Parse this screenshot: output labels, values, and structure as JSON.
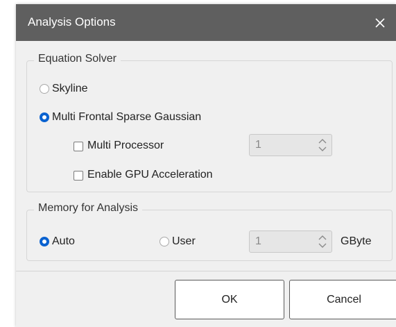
{
  "dialog": {
    "title": "Analysis Options",
    "close_icon": "close-icon"
  },
  "solver": {
    "legend": "Equation Solver",
    "skyline_label": "Skyline",
    "skyline_checked": false,
    "multifrontal_label": "Multi Frontal Sparse Gaussian",
    "multifrontal_checked": true,
    "multi_processor_label": "Multi Processor",
    "multi_processor_checked": false,
    "multi_processor_value": "1",
    "gpu_label": "Enable GPU Acceleration",
    "gpu_checked": false
  },
  "memory": {
    "legend": "Memory for Analysis",
    "auto_label": "Auto",
    "auto_checked": true,
    "user_label": "User",
    "user_checked": false,
    "user_value": "1",
    "unit": "GByte"
  },
  "buttons": {
    "ok": "OK",
    "cancel": "Cancel"
  },
  "colors": {
    "titlebar": "#5f5f5f",
    "accent": "#0a62d0",
    "dialog_bg": "#f0f0f0"
  }
}
